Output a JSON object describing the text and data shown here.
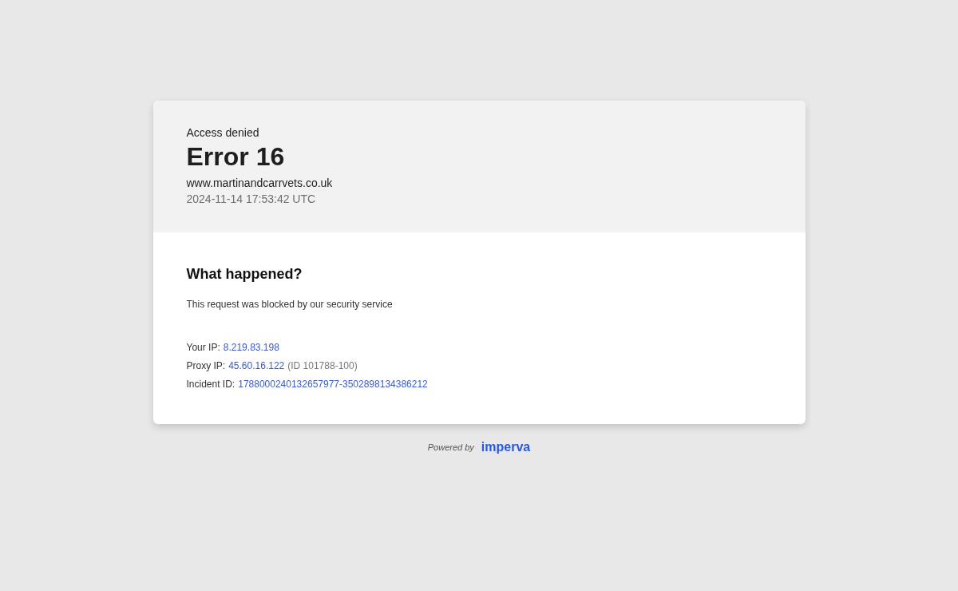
{
  "header": {
    "subtitle": "Access denied",
    "title": "Error 16",
    "host": "www.martinandcarrvets.co.uk",
    "timestamp": "2024-11-14 17:53:42 UTC"
  },
  "body": {
    "heading": "What happened?",
    "message": "This request was blocked by our security service",
    "details": [
      {
        "label": "Your IP:",
        "value": "8.219.83.198"
      },
      {
        "label": "Proxy IP:",
        "value": "45.60.16.122",
        "note": "(ID 101788-100)"
      },
      {
        "label": "Incident ID:",
        "value": "1788000240132657977-3502898134386212"
      }
    ]
  },
  "footer": {
    "powered_by": "Powered by",
    "brand": "imperva"
  }
}
